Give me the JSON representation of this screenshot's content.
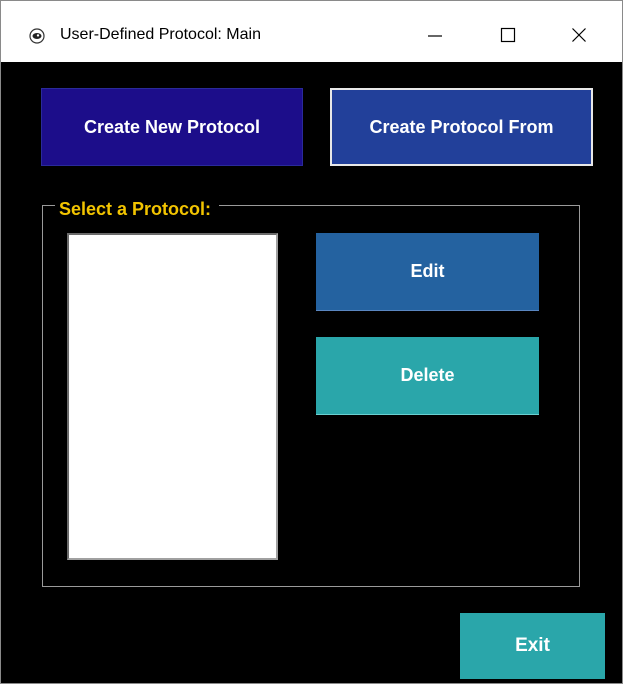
{
  "window": {
    "title": "User-Defined Protocol: Main",
    "icon": "app-eye-icon",
    "controls": {
      "minimize": "minimize-icon",
      "maximize": "maximize-icon",
      "close": "close-icon"
    }
  },
  "toolbar": {
    "create_new_label": "Create New Protocol",
    "create_from_label": "Create Protocol From"
  },
  "protocol_group": {
    "legend": "Select a Protocol:",
    "items": []
  },
  "actions": {
    "edit_label": "Edit",
    "delete_label": "Delete"
  },
  "footer": {
    "exit_label": "Exit"
  },
  "colors": {
    "background": "#000000",
    "create_new": "#1c0d8a",
    "create_from": "#22409a",
    "edit": "#2462a0",
    "delete": "#2aa6aa",
    "exit": "#2aa6aa",
    "legend_text": "#f2c400"
  }
}
